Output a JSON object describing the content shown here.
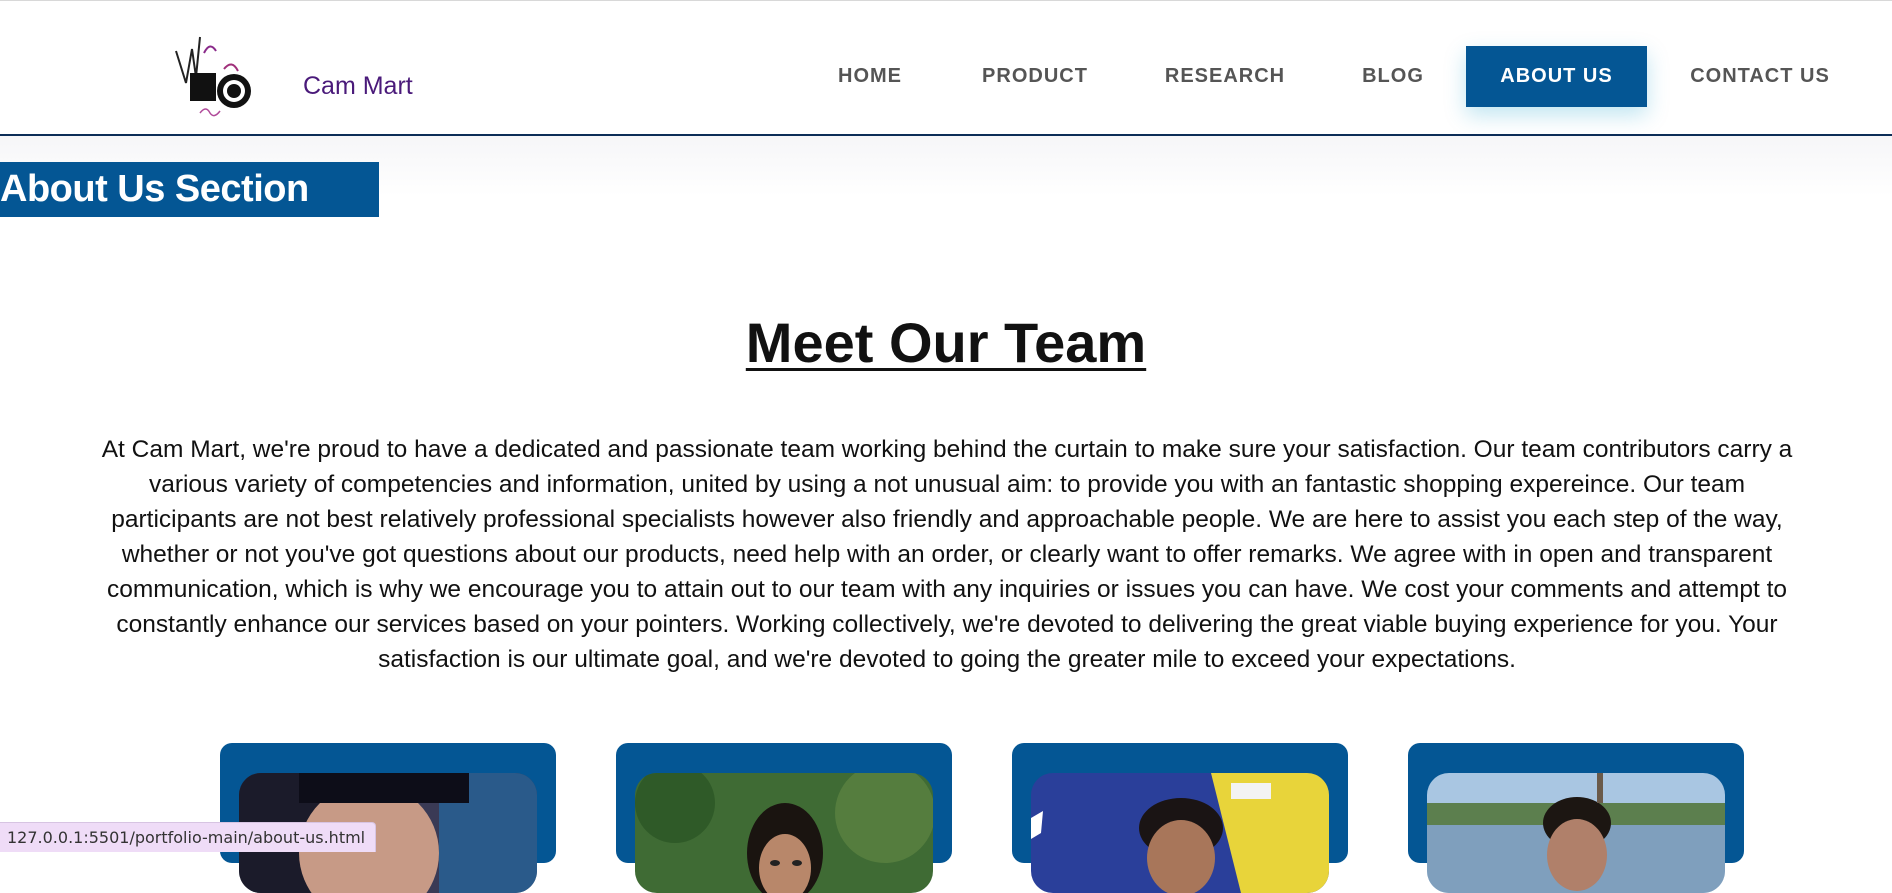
{
  "brand": {
    "name": "Cam Mart"
  },
  "nav": {
    "items": [
      {
        "label": "HOME",
        "active": false
      },
      {
        "label": "PRODUCT",
        "active": false
      },
      {
        "label": "RESEARCH",
        "active": false
      },
      {
        "label": "BLOG",
        "active": false
      },
      {
        "label": "ABOUT US",
        "active": true
      },
      {
        "label": "CONTACT US",
        "active": false
      }
    ]
  },
  "section": {
    "label": "About Us Section"
  },
  "team": {
    "title": "Meet Our Team",
    "description": "At Cam Mart, we're proud to have a dedicated and passionate team working behind the curtain to make sure your satisfaction. Our team contributors carry a various variety of competencies and information, united by using a not unusual aim: to provide you with an fantastic shopping expereince. Our team participants are not best relatively professional specialists however also friendly and approachable people. We are here to assist you each step of the way, whether or not you've got questions about our products, need help with an order, or clearly want to offer remarks. We agree with in open and transparent communication, which is why we encourage you to attain out to our team with any inquiries or issues you can have. We cost your comments and attempt to constantly enhance our services based on your pointers. Working collectively, we're devoted to delivering the great viable buying experience for you. Your satisfaction is our ultimate goal, and we're devoted to going the greater mile to exceed your expectations.",
    "members": [
      {
        "photo": "team-member-photo-1"
      },
      {
        "photo": "team-member-photo-2"
      },
      {
        "photo": "team-member-photo-3"
      },
      {
        "photo": "team-member-photo-4"
      }
    ]
  },
  "status_bar": {
    "url": "127.0.0.1:5501/portfolio-main/about-us.html"
  },
  "colors": {
    "accent": "#045694",
    "brand_text": "#4a1a7a",
    "nav_text": "#555555",
    "status_bar_bg": "#efdcf7"
  }
}
